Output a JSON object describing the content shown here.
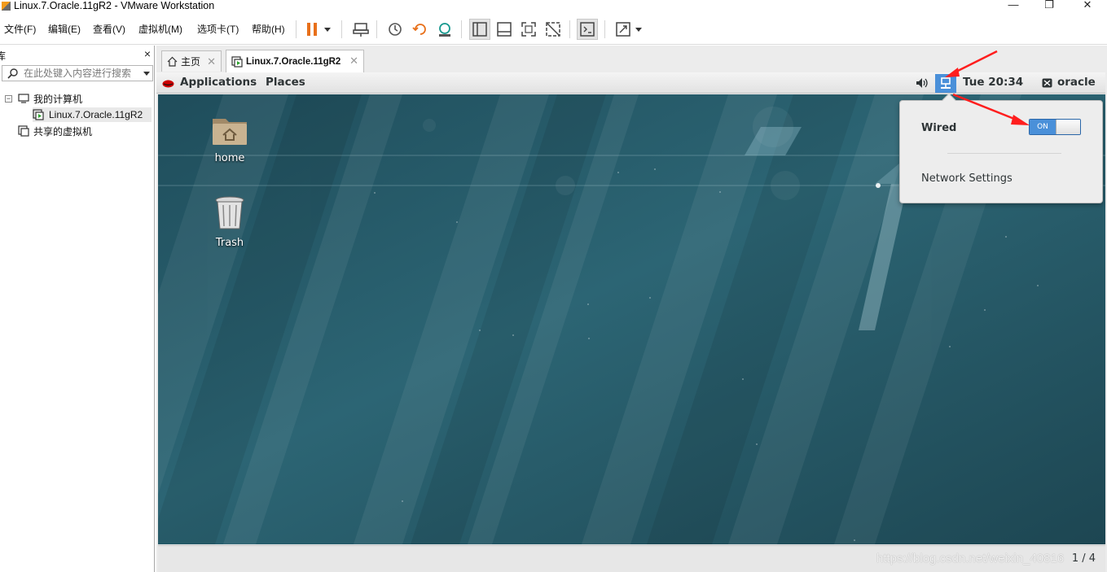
{
  "window": {
    "title": "Linux.7.Oracle.11gR2 - VMware Workstation",
    "minimize": "—",
    "maximize": "❐",
    "close": "✕"
  },
  "menu": {
    "items": [
      "文件(F)",
      "编辑(E)",
      "查看(V)",
      "虚拟机(M)",
      "选项卡(T)",
      "帮助(H)"
    ]
  },
  "toolbar": {
    "icons": [
      "pause-icon",
      "send-ctrl-alt-del-icon",
      "snapshot-icon",
      "revert-snapshot-icon",
      "snapshot-manager-icon",
      "show-library-icon",
      "thumbnail-bar-icon",
      "fullscreen-icon",
      "unity-icon",
      "console-view-icon",
      "stretch-icon"
    ],
    "accent": "#e8701a"
  },
  "library": {
    "title": "库",
    "close": "×",
    "search_placeholder": "在此处键入内容进行搜索",
    "tree": {
      "my_computer": "我的计算机",
      "vm": "Linux.7.Oracle.11gR2",
      "shared": "共享的虚拟机"
    },
    "expander": "−"
  },
  "tabs": [
    {
      "label": "主页",
      "icon": "home-icon"
    },
    {
      "label": "Linux.7.Oracle.11gR2",
      "icon": "vm-icon",
      "active": true
    }
  ],
  "guest": {
    "menus": {
      "applications": "Applications",
      "places": "Places"
    },
    "clock": "Tue 20:34",
    "user": "oracle",
    "desktop_icons": {
      "home": "home",
      "trash": "Trash"
    },
    "network_popover": {
      "wired": "Wired",
      "toggle_state": "ON",
      "settings": "Network Settings"
    },
    "pager": "1 / 4",
    "accent": "#4a90d9"
  },
  "watermark": "https://blog.csdn.net/weixin_40816"
}
